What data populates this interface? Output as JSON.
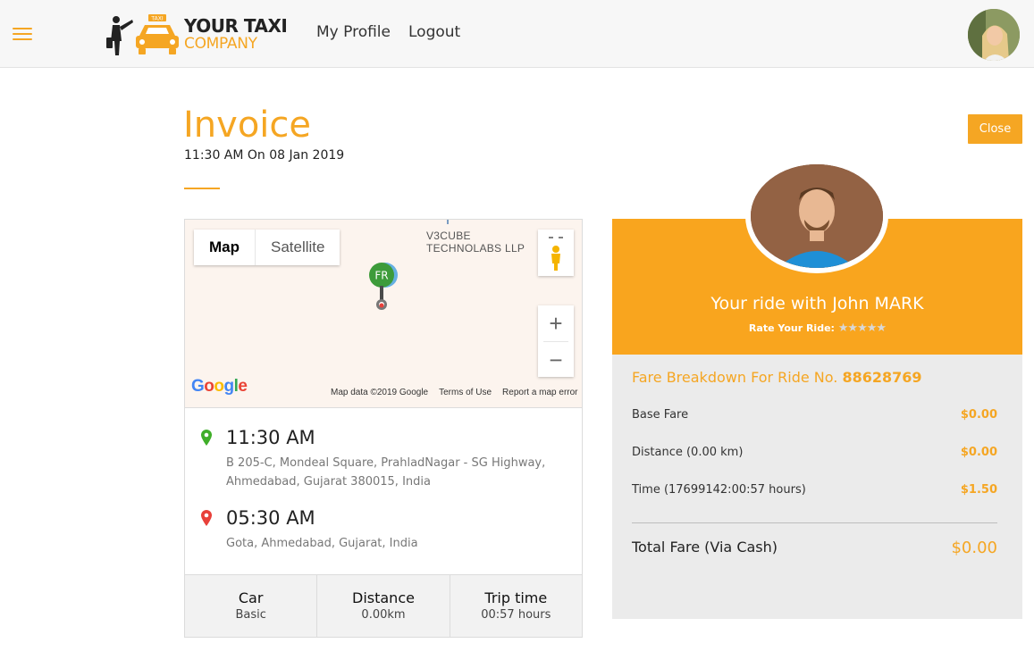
{
  "header": {
    "logo_line1": "YOUR TAXI",
    "logo_line2": "COMPANY",
    "logo_badge": "TAXI",
    "nav": [
      "My Profile",
      "Logout"
    ]
  },
  "invoice": {
    "title": "Invoice",
    "datetime": "11:30 AM On 08 Jan 2019",
    "close_label": "Close"
  },
  "map": {
    "type_map": "Map",
    "type_satellite": "Satellite",
    "poi_label_line1": "V3CUBE",
    "poi_label_line2": "TECHNOLABS LLP",
    "marker_label": "FR",
    "google": "Google",
    "footer": [
      "Map data ©2019 Google",
      "Terms of Use",
      "Report a map error"
    ],
    "zoom_in": "+",
    "zoom_out": "−"
  },
  "trip": {
    "pickup": {
      "time": "11:30 AM",
      "address": "B 205-C, Mondeal Square, PrahladNagar - SG Highway, Ahmedabad, Gujarat 380015, India"
    },
    "dropoff": {
      "time": "05:30 AM",
      "address": "Gota, Ahmedabad, Gujarat, India"
    },
    "stats": [
      {
        "label": "Car",
        "value": "Basic"
      },
      {
        "label": "Distance",
        "value": "0.00km"
      },
      {
        "label": "Trip time",
        "value": "00:57 hours"
      }
    ]
  },
  "driver": {
    "ride_with": "Your ride with John MARK",
    "rate_label": "Rate Your Ride:",
    "stars": "★★★★★"
  },
  "fare": {
    "title_prefix": "Fare Breakdown For Ride No.",
    "ride_no": "88628769",
    "rows": [
      {
        "label": "Base Fare",
        "value": "$0.00"
      },
      {
        "label": "Distance (0.00 km)",
        "value": "$0.00"
      },
      {
        "label": "Time (17699142:00:57 hours)",
        "value": "$1.50"
      }
    ],
    "total_label": "Total Fare (Via Cash)",
    "total_value": "$0.00"
  },
  "colors": {
    "accent": "#f5a623",
    "band": "#f9a51e",
    "pickup_pin": "#3fae29",
    "dropoff_pin": "#e8403a"
  }
}
